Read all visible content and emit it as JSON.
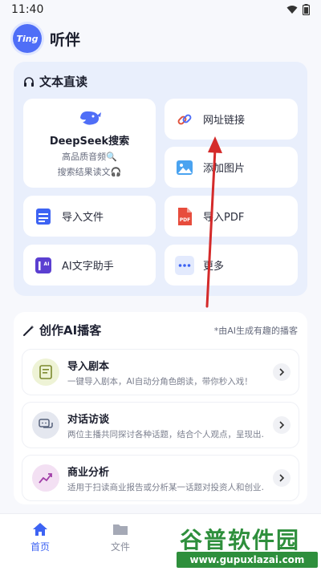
{
  "status_bar": {
    "time": "11:40"
  },
  "app": {
    "logo_text": "Ting",
    "title": "听伴"
  },
  "reading": {
    "title": "文本直读",
    "deepseek": {
      "title": "DeepSeek搜索",
      "line1": "高品质音频🔍",
      "line2": "搜索结果读文🎧"
    },
    "tiles": {
      "url": "网址链接",
      "image": "添加图片",
      "import_file": "导入文件",
      "import_pdf": "导入PDF",
      "ai_writer": "AI文字助手",
      "more": "更多"
    },
    "pdf_badge": "PDF",
    "ai_badge": "AI"
  },
  "ai_podcast": {
    "title": "创作AI播客",
    "hint": "*由AI生成有趣的播客",
    "items": [
      {
        "title": "导入剧本",
        "desc": "一键导入剧本，AI自动分角色朗读，带你秒入戏！"
      },
      {
        "title": "对话访谈",
        "desc": "两位主播共同探讨各种话题，结合个人观点，呈现出…"
      },
      {
        "title": "商业分析",
        "desc": "适用于扫读商业报告或分析某一话题对投资人和创业…"
      }
    ]
  },
  "bottom_nav": {
    "home": "首页",
    "files": "文件"
  },
  "watermark": {
    "brand": "谷普软件园",
    "url": "www.gupuxlazai.com"
  },
  "colors": {
    "accent": "#3d63f3",
    "annotation_arrow": "#d42a2a"
  }
}
